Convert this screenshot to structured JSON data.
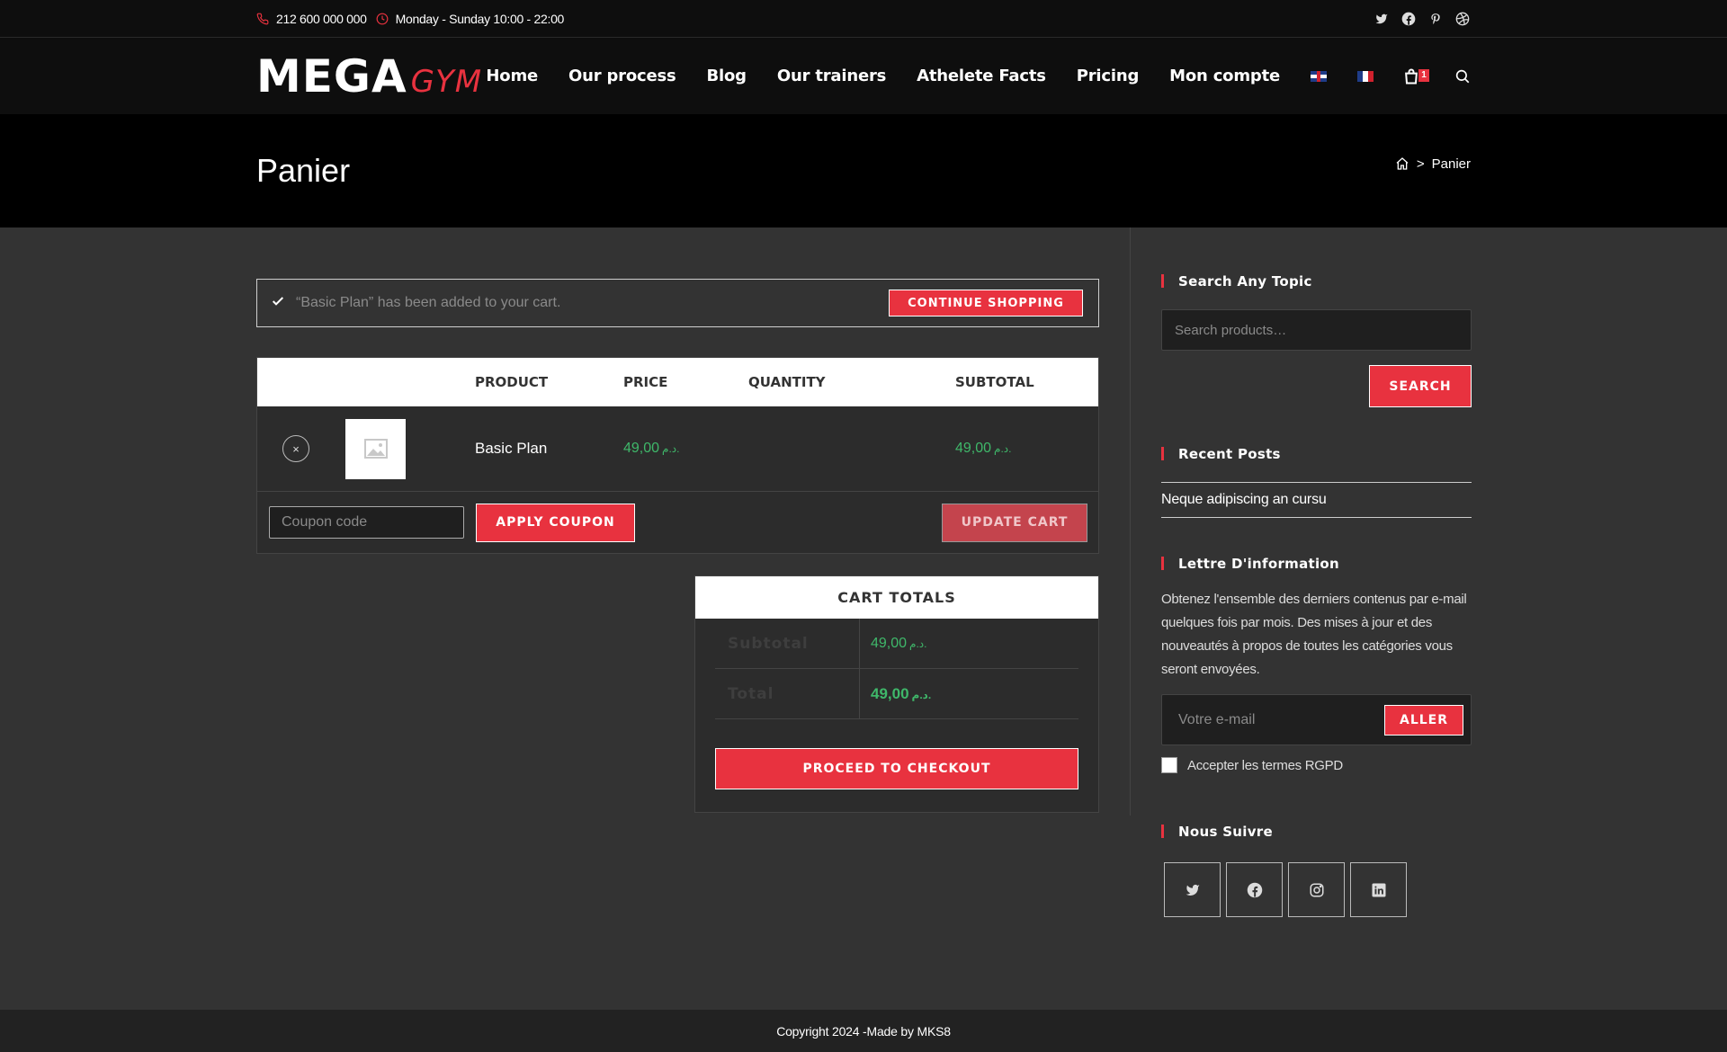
{
  "topbar": {
    "phone": "212 600 000 000",
    "hours": "Monday - Sunday 10:00 - 22:00",
    "social_icons": [
      "twitter-icon",
      "facebook-icon",
      "pinterest-icon",
      "dribbble-icon"
    ]
  },
  "header": {
    "logo_main": "MEGA",
    "logo_sub": "GYM",
    "nav": [
      "Home",
      "Our process",
      "Blog",
      "Our trainers",
      "Athelete Facts",
      "Pricing",
      "Mon compte"
    ],
    "cart_count": "1"
  },
  "titlebar": {
    "title": "Panier",
    "breadcrumb_current": "Panier",
    "breadcrumb_sep": ">"
  },
  "notice": {
    "message": "“Basic Plan” has been added to your cart.",
    "button": "Continue shopping"
  },
  "cart": {
    "headers": [
      "Product",
      "Price",
      "Quantity",
      "Subtotal"
    ],
    "item": {
      "remove": "×",
      "name": "Basic Plan",
      "price": "49,00",
      "subtotal": "49,00",
      "currency": "د.م."
    },
    "coupon_placeholder": "Coupon code",
    "apply_label": "Apply coupon",
    "update_label": "Update cart"
  },
  "totals": {
    "title": "Cart totals",
    "subtotal_label": "Subtotal",
    "subtotal_value": "49,00",
    "total_label": "Total",
    "total_value": "49,00",
    "currency": "د.م.",
    "checkout_label": "Proceed to checkout"
  },
  "sidebar": {
    "search_title": "Search Any Topic",
    "search_placeholder": "Search products…",
    "search_button": "Search",
    "recent_title": "Recent Posts",
    "recent_posts": [
      "Neque adipiscing an cursu"
    ],
    "news_title": "Lettre D'information",
    "news_text": "Obtenez l'ensemble des derniers contenus par e-mail quelques fois par mois. Des mises à jour et des nouveautés à propos de toutes les catégories vous seront envoyées.",
    "email_placeholder": "Votre e-mail",
    "news_button": "Aller",
    "gdpr_label": "Accepter les termes RGPD",
    "follow_title": "Nous Suivre",
    "follow_icons": [
      "twitter-icon",
      "facebook-icon",
      "instagram-icon",
      "linkedin-icon"
    ]
  },
  "footer": {
    "copyright": "Copyright 2024 -Made by MKS8"
  },
  "colors": {
    "accent": "#e8323f",
    "price_green": "#3fb86a",
    "background": "#333333",
    "header_bg": "#0e0e0e"
  }
}
